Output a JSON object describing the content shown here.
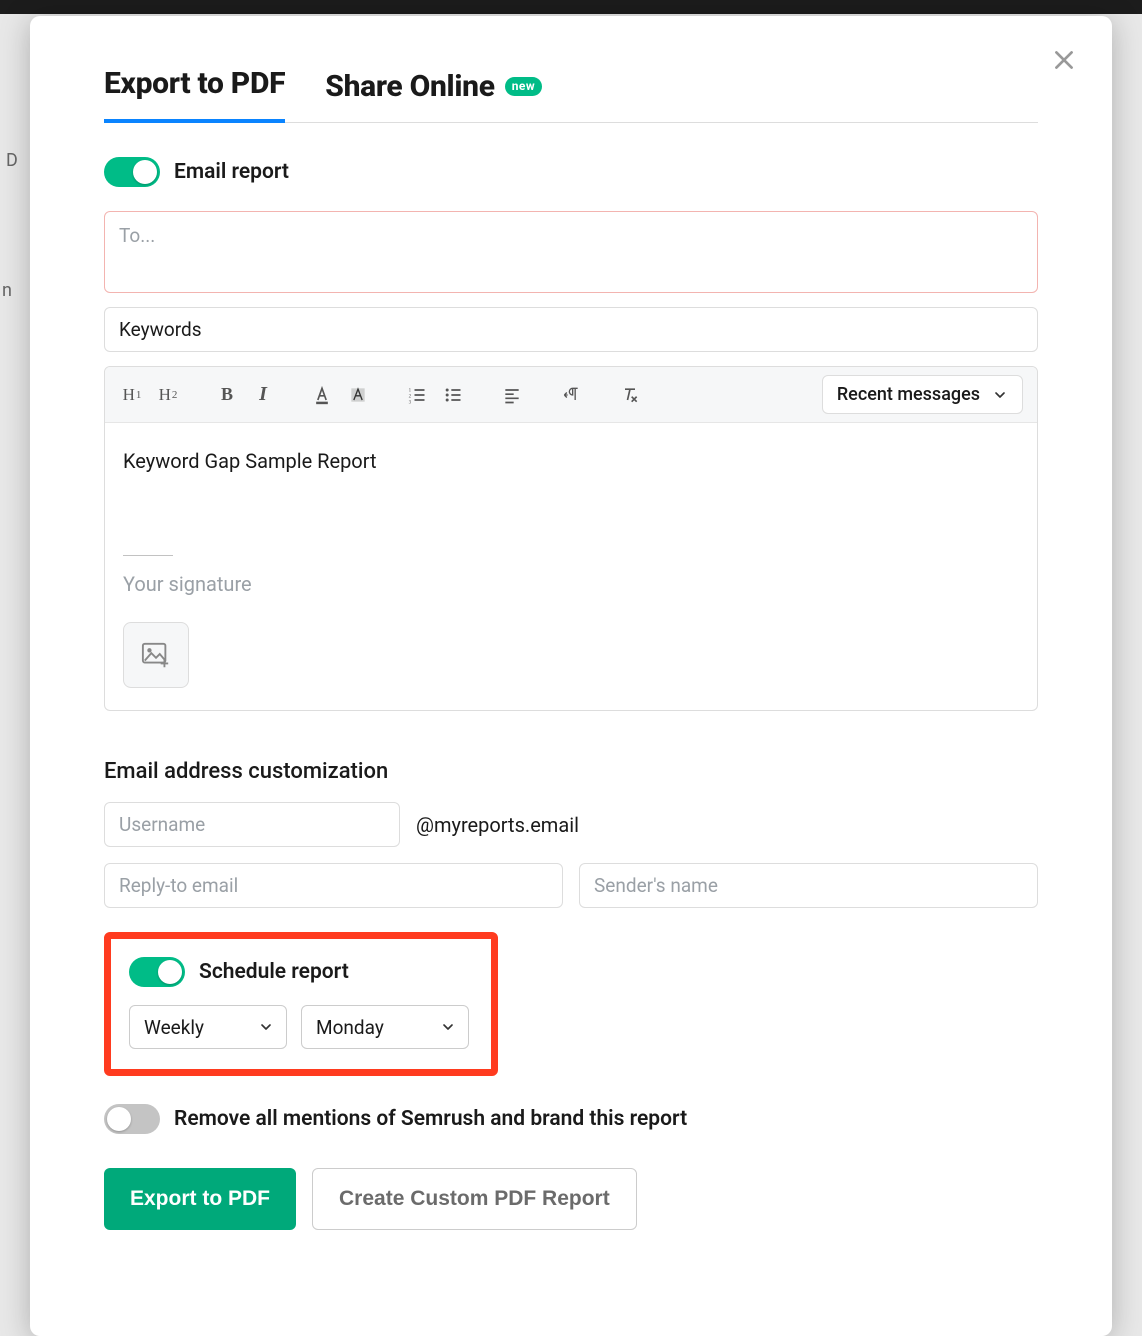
{
  "tabs": {
    "export_label": "Export to PDF",
    "share_label": "Share Online",
    "share_badge": "new"
  },
  "email_report": {
    "toggle_label": "Email report",
    "to_placeholder": "To...",
    "subject_value": "Keywords"
  },
  "editor": {
    "recent_label": "Recent messages",
    "body_text": "Keyword Gap Sample Report",
    "signature_placeholder": "Your signature"
  },
  "customization": {
    "title": "Email address customization",
    "username_placeholder": "Username",
    "domain_suffix": "@myreports.email",
    "reply_to_placeholder": "Reply-to email",
    "sender_name_placeholder": "Sender's name"
  },
  "schedule": {
    "toggle_label": "Schedule report",
    "frequency_value": "Weekly",
    "day_value": "Monday"
  },
  "branding": {
    "toggle_label": "Remove all mentions of Semrush and brand this report"
  },
  "buttons": {
    "export_label": "Export to PDF",
    "custom_label": "Create Custom PDF Report"
  }
}
